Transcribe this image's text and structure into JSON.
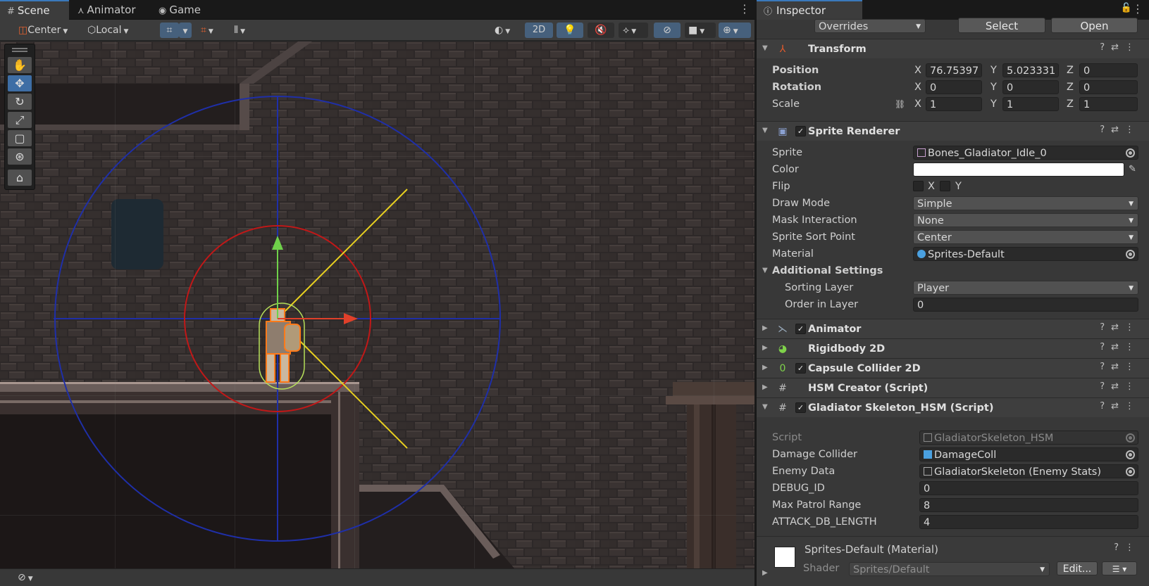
{
  "tabs": [
    {
      "label": "Scene",
      "icon": "grid-hash-icon"
    },
    {
      "label": "Animator",
      "icon": "animator-icon"
    },
    {
      "label": "Game",
      "icon": "gamepad-icon"
    }
  ],
  "scene_toolbar": {
    "pivot": "Center",
    "space": "Local",
    "mode_2d": "2D"
  },
  "inspector": {
    "title": "Inspector",
    "prefab": {
      "overrides": "Overrides",
      "select": "Select",
      "open": "Open"
    },
    "transform": {
      "title": "Transform",
      "position": {
        "label": "Position",
        "x": "76.75397",
        "y": "5.023331",
        "z": "0"
      },
      "rotation": {
        "label": "Rotation",
        "x": "0",
        "y": "0",
        "z": "0"
      },
      "scale": {
        "label": "Scale",
        "x": "1",
        "y": "1",
        "z": "1"
      },
      "axis_x": "X",
      "axis_y": "Y",
      "axis_z": "Z"
    },
    "sprite_renderer": {
      "title": "Sprite Renderer",
      "sprite_label": "Sprite",
      "sprite": "Bones_Gladiator_Idle_0",
      "color_label": "Color",
      "color": "#ffffff",
      "flip_label": "Flip",
      "flip_x": "X",
      "flip_y": "Y",
      "draw_mode_label": "Draw Mode",
      "draw_mode": "Simple",
      "mask_label": "Mask Interaction",
      "mask": "None",
      "sort_point_label": "Sprite Sort Point",
      "sort_point": "Center",
      "material_label": "Material",
      "material": "Sprites-Default",
      "additional": "Additional Settings",
      "sorting_layer_label": "Sorting Layer",
      "sorting_layer": "Player",
      "order_label": "Order in Layer",
      "order": "0"
    },
    "components": {
      "animator": "Animator",
      "rigidbody": "Rigidbody 2D",
      "capsule": "Capsule Collider 2D",
      "hsm_creator": "HSM Creator (Script)",
      "gladiator": "Gladiator Skeleton_HSM (Script)"
    },
    "gladiator": {
      "script_label": "Script",
      "script": "GladiatorSkeleton_HSM",
      "damage_label": "Damage Collider",
      "damage": "DamageColl",
      "enemy_label": "Enemy Data",
      "enemy": "GladiatorSkeleton (Enemy Stats)",
      "debug_label": "DEBUG_ID",
      "debug": "0",
      "patrol_label": "Max Patrol Range",
      "patrol": "8",
      "attack_label": "ATTACK_DB_LENGTH",
      "attack": "4"
    },
    "material": {
      "name": "Sprites-Default (Material)",
      "shader_label": "Shader",
      "shader": "Sprites/Default",
      "edit": "Edit..."
    }
  },
  "colors": {
    "accent": "#3a79bb",
    "gizmo_blue": "#1f2fa8",
    "gizmo_red": "#c01818",
    "gizmo_yellow": "#e8d020",
    "axis_green": "#6fd14a",
    "axis_red": "#e0402a"
  }
}
